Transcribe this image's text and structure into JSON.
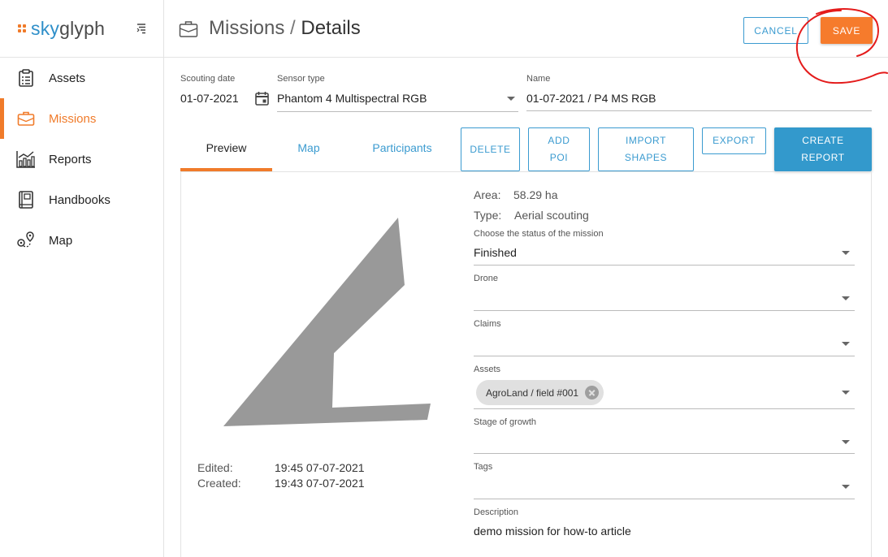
{
  "app": {
    "logo_sky": "sky",
    "logo_glyph": "glyph",
    "brand_colors": {
      "orange": "#f07b2a",
      "blue": "#3b9bd0"
    }
  },
  "sidebar": {
    "items": [
      {
        "label": "Assets",
        "icon": "clipboard-icon",
        "active": false
      },
      {
        "label": "Missions",
        "icon": "briefcase-icon",
        "active": true
      },
      {
        "label": "Reports",
        "icon": "chart-icon",
        "active": false
      },
      {
        "label": "Handbooks",
        "icon": "book-icon",
        "active": false
      },
      {
        "label": "Map",
        "icon": "route-icon",
        "active": false
      }
    ]
  },
  "header": {
    "section": "Missions",
    "separator": "/",
    "page": "Details",
    "cancel_label": "CANCEL",
    "save_label": "SAVE"
  },
  "form": {
    "scouting_date": {
      "label": "Scouting date",
      "value": "01-07-2021"
    },
    "sensor_type": {
      "label": "Sensor type",
      "value": "Phantom 4 Multispectral RGB"
    },
    "name": {
      "label": "Name",
      "value": "01-07-2021 / P4 MS RGB"
    }
  },
  "tabs": [
    {
      "label": "Preview",
      "active": true
    },
    {
      "label": "Map",
      "active": false
    },
    {
      "label": "Participants",
      "active": false
    }
  ],
  "actions": {
    "delete": "DELETE",
    "add_poi_1": "ADD",
    "add_poi_2": "POI",
    "import_1": "IMPORT",
    "import_2": "SHAPES",
    "export": "EXPORT",
    "create_1": "CREATE",
    "create_2": "REPORT"
  },
  "details": {
    "area_label": "Area:",
    "area_value": "58.29 ha",
    "type_label": "Type:",
    "type_value": "Aerial scouting",
    "status_label": "Choose the status of the mission",
    "status_value": "Finished",
    "drone_label": "Drone",
    "drone_value": "",
    "claims_label": "Claims",
    "claims_value": "",
    "assets_label": "Assets",
    "assets_chip": "AgroLand / field #001",
    "stage_label": "Stage of growth",
    "stage_value": "",
    "tags_label": "Tags",
    "tags_value": "",
    "description_label": "Description",
    "description_value": "demo mission for how-to article"
  },
  "timestamps": {
    "edited_label": "Edited:",
    "edited_value": "19:45 07-07-2021",
    "created_label": "Created:",
    "created_value": "19:43 07-07-2021"
  }
}
